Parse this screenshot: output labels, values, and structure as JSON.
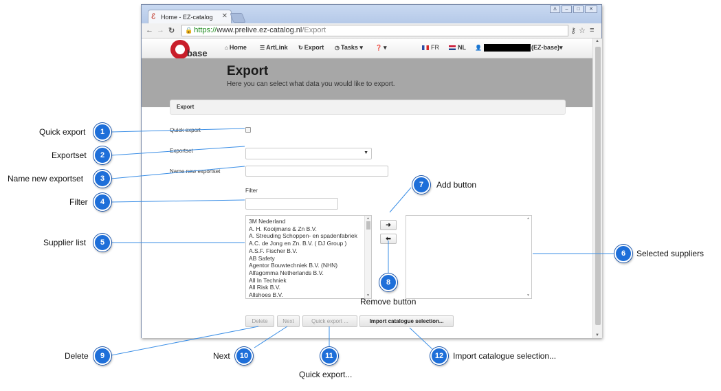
{
  "browser": {
    "tab_title": "Home - EZ-catalog",
    "url_scheme": "https://",
    "url_host": "www.prelive.ez-catalog.nl",
    "url_path": "/Export"
  },
  "nav": {
    "logo_text": "base",
    "items": [
      {
        "label": "Home",
        "icon": "home-icon"
      },
      {
        "label": "ArtLink",
        "icon": "list-icon"
      },
      {
        "label": "Export",
        "icon": "refresh-icon"
      },
      {
        "label": "Tasks",
        "icon": "clock-icon"
      },
      {
        "label": "",
        "icon": "help-icon"
      }
    ],
    "lang_fr": "FR",
    "lang_nl": "NL",
    "user_suffix": "(EZ-base)"
  },
  "page": {
    "title": "Export",
    "subtitle": "Here you can select what data you would like to export.",
    "panel_title": "Export"
  },
  "form": {
    "quick_export_label": "Quick export",
    "exportset_label": "Exportset",
    "name_new_label": "Name new exportset",
    "filter_label": "Filter",
    "suppliers": [
      "3M Nederland",
      "A. H. Kooijmans & Zn B.V.",
      "A. Streuding Schoppen- en spadenfabriek",
      "A.C. de Jong en Zn. B.V. ( DJ Group )",
      "A.S.F. Fischer B.V.",
      "AB Safety",
      "Agentor Bouwtechniek B.V. (NHN)",
      "Alfagomma Netherlands B.V.",
      "All In Techniek",
      "All Risk B.V.",
      "Allshoes B.V."
    ],
    "add_symbol": "➜",
    "remove_symbol": "⬅"
  },
  "buttons": {
    "delete": "Delete",
    "next": "Next",
    "quick_export": "Quick export ...",
    "import_catalogue": "Import catalogue selection..."
  },
  "annotations": [
    {
      "number": "1",
      "label": "Quick export"
    },
    {
      "number": "2",
      "label": "Exportset"
    },
    {
      "number": "3",
      "label": "Name new exportset"
    },
    {
      "number": "4",
      "label": "Filter"
    },
    {
      "number": "5",
      "label": "Supplier list"
    },
    {
      "number": "6",
      "label": "Selected suppliers"
    },
    {
      "number": "7",
      "label": "Add button"
    },
    {
      "number": "8",
      "label": "Remove button"
    },
    {
      "number": "9",
      "label": "Delete"
    },
    {
      "number": "10",
      "label": "Next"
    },
    {
      "number": "11",
      "label": "Quick export..."
    },
    {
      "number": "12",
      "label": "Import catalogue selection..."
    }
  ],
  "colors": {
    "badge": "#1e6fd9",
    "hero": "#a7a7a7",
    "logo_red": "#c91e2a",
    "callout_line": "#3a8ee6"
  }
}
